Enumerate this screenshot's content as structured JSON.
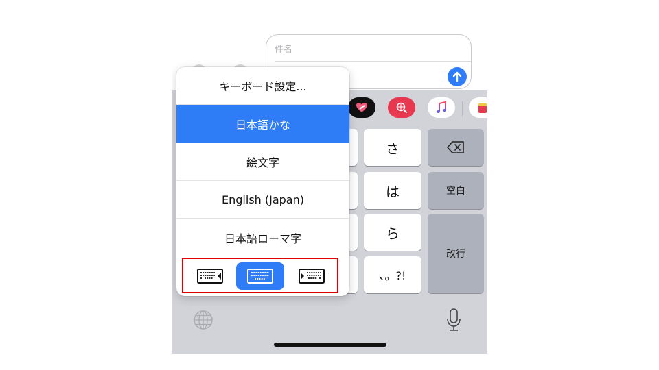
{
  "compose": {
    "subject_placeholder": "件名",
    "send_icon": "arrow-up-icon"
  },
  "app_strip": [
    {
      "name": "heart-stickers-app",
      "color": "#111111"
    },
    {
      "name": "image-search-app",
      "color": "#e8384f"
    },
    {
      "name": "music-app",
      "color": "#ffffff"
    },
    {
      "name": "more-app",
      "color": "#ffffff"
    }
  ],
  "keyboard": {
    "keys": {
      "sa": "さ",
      "ha": "は",
      "ra": "ら",
      "punct": "、。?!",
      "space": "空白",
      "return": "改行"
    },
    "delete_icon": "delete-backspace-icon",
    "globe_icon": "globe-icon",
    "mic_icon": "microphone-icon"
  },
  "menu": {
    "items": [
      {
        "label": "キーボード設定...",
        "selected": false
      },
      {
        "label": "日本語かな",
        "selected": true
      },
      {
        "label": "絵文字",
        "selected": false
      },
      {
        "label": "English (Japan)",
        "selected": false
      },
      {
        "label": "日本語ローマ字",
        "selected": false
      }
    ],
    "layout_options": [
      {
        "name": "keyboard-left-icon",
        "active": false
      },
      {
        "name": "keyboard-full-icon",
        "active": true
      },
      {
        "name": "keyboard-right-icon",
        "active": false
      }
    ],
    "highlight_color": "#e00000",
    "accent_color": "#2f7df6"
  }
}
